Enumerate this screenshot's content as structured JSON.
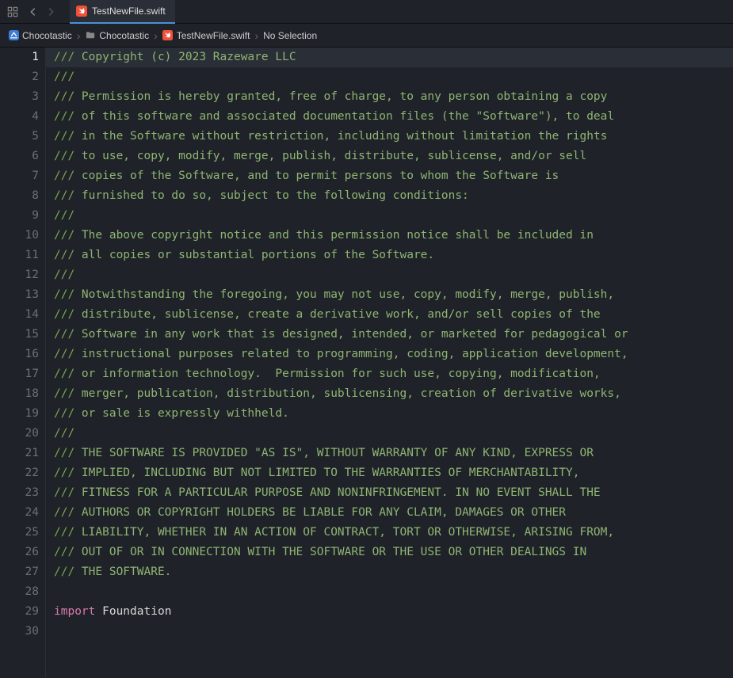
{
  "tab": {
    "filename": "TestNewFile.swift"
  },
  "breadcrumb": {
    "project": "Chocotastic",
    "group": "Chocotastic",
    "file": "TestNewFile.swift",
    "selection": "No Selection"
  },
  "code": {
    "lines": [
      {
        "n": 1,
        "type": "doc",
        "text": "Copyright (c) 2023 Razeware LLC",
        "current": true
      },
      {
        "n": 2,
        "type": "doc",
        "text": ""
      },
      {
        "n": 3,
        "type": "doc",
        "text": "Permission is hereby granted, free of charge, to any person obtaining a copy"
      },
      {
        "n": 4,
        "type": "doc",
        "text": "of this software and associated documentation files (the \"Software\"), to deal"
      },
      {
        "n": 5,
        "type": "doc",
        "text": "in the Software without restriction, including without limitation the rights"
      },
      {
        "n": 6,
        "type": "doc",
        "text": "to use, copy, modify, merge, publish, distribute, sublicense, and/or sell"
      },
      {
        "n": 7,
        "type": "doc",
        "text": "copies of the Software, and to permit persons to whom the Software is"
      },
      {
        "n": 8,
        "type": "doc",
        "text": "furnished to do so, subject to the following conditions:"
      },
      {
        "n": 9,
        "type": "doc",
        "text": ""
      },
      {
        "n": 10,
        "type": "doc",
        "text": "The above copyright notice and this permission notice shall be included in"
      },
      {
        "n": 11,
        "type": "doc",
        "text": "all copies or substantial portions of the Software."
      },
      {
        "n": 12,
        "type": "doc",
        "text": ""
      },
      {
        "n": 13,
        "type": "doc",
        "text": "Notwithstanding the foregoing, you may not use, copy, modify, merge, publish,"
      },
      {
        "n": 14,
        "type": "doc",
        "text": "distribute, sublicense, create a derivative work, and/or sell copies of the"
      },
      {
        "n": 15,
        "type": "doc",
        "text": "Software in any work that is designed, intended, or marketed for pedagogical or"
      },
      {
        "n": 16,
        "type": "doc",
        "text": "instructional purposes related to programming, coding, application development,"
      },
      {
        "n": 17,
        "type": "doc",
        "text": "or information technology.  Permission for such use, copying, modification,"
      },
      {
        "n": 18,
        "type": "doc",
        "text": "merger, publication, distribution, sublicensing, creation of derivative works,"
      },
      {
        "n": 19,
        "type": "doc",
        "text": "or sale is expressly withheld."
      },
      {
        "n": 20,
        "type": "doc",
        "text": ""
      },
      {
        "n": 21,
        "type": "doc",
        "text": "THE SOFTWARE IS PROVIDED \"AS IS\", WITHOUT WARRANTY OF ANY KIND, EXPRESS OR"
      },
      {
        "n": 22,
        "type": "doc",
        "text": "IMPLIED, INCLUDING BUT NOT LIMITED TO THE WARRANTIES OF MERCHANTABILITY,"
      },
      {
        "n": 23,
        "type": "doc",
        "text": "FITNESS FOR A PARTICULAR PURPOSE AND NONINFRINGEMENT. IN NO EVENT SHALL THE"
      },
      {
        "n": 24,
        "type": "doc",
        "text": "AUTHORS OR COPYRIGHT HOLDERS BE LIABLE FOR ANY CLAIM, DAMAGES OR OTHER"
      },
      {
        "n": 25,
        "type": "doc",
        "text": "LIABILITY, WHETHER IN AN ACTION OF CONTRACT, TORT OR OTHERWISE, ARISING FROM,"
      },
      {
        "n": 26,
        "type": "doc",
        "text": "OUT OF OR IN CONNECTION WITH THE SOFTWARE OR THE USE OR OTHER DEALINGS IN"
      },
      {
        "n": 27,
        "type": "doc",
        "text": "THE SOFTWARE."
      },
      {
        "n": 28,
        "type": "blank",
        "text": ""
      },
      {
        "n": 29,
        "type": "import",
        "kw": "import",
        "id": "Foundation"
      },
      {
        "n": 30,
        "type": "blank",
        "text": ""
      }
    ]
  }
}
